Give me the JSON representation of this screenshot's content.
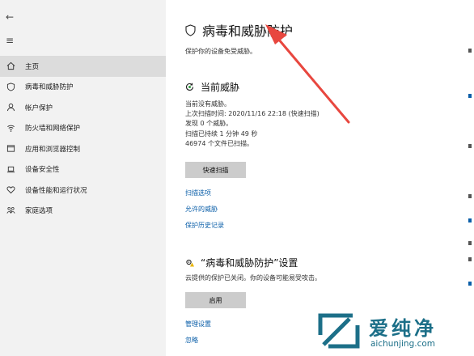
{
  "sidebar": {
    "back_glyph": "←",
    "menu_glyph": "≡",
    "items": [
      {
        "label": "主页",
        "icon": "home-icon"
      },
      {
        "label": "病毒和威胁防护",
        "icon": "shield-icon"
      },
      {
        "label": "帐户保护",
        "icon": "person-icon"
      },
      {
        "label": "防火墙和网络保护",
        "icon": "wifi-icon"
      },
      {
        "label": "应用和浏览器控制",
        "icon": "window-icon"
      },
      {
        "label": "设备安全性",
        "icon": "laptop-icon"
      },
      {
        "label": "设备性能和运行状况",
        "icon": "heart-icon"
      },
      {
        "label": "家庭选项",
        "icon": "family-icon"
      }
    ]
  },
  "main": {
    "title": "病毒和威胁防护",
    "subtitle": "保护你的设备免受威胁。",
    "current_threats": {
      "title": "当前威胁",
      "lines": [
        "当前没有威胁。",
        "上次扫描时间: 2020/11/16 22:18 (快速扫描)",
        "发现 0 个威胁。",
        "扫描已持续 1 分钟 49 秒",
        "46974 个文件已扫描。"
      ],
      "quick_scan_label": "快速扫描",
      "links": [
        "扫描选项",
        "允许的威胁",
        "保护历史记录"
      ]
    },
    "settings": {
      "title": "“病毒和威胁防护”设置",
      "description": "云提供的保护已关闭。你的设备可能易受攻击。",
      "enable_label": "启用",
      "links": [
        "管理设置",
        "忽略"
      ]
    }
  },
  "watermark": {
    "brand": "爱纯净",
    "url": "aichunjing.com"
  },
  "colors": {
    "sidebar_bg": "#f2f2f2",
    "link": "#0a5ea8",
    "button": "#cccccc",
    "arrow": "#e8473f",
    "watermark": "#1c6f88"
  }
}
